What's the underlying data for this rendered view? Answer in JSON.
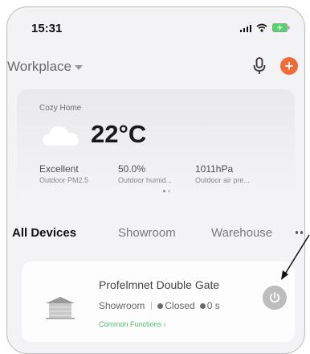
{
  "status_bar": {
    "time": "15:31"
  },
  "header": {
    "location": "Workplace"
  },
  "weather": {
    "home_name": "Cozy Home",
    "temperature": "22°C",
    "stats": [
      {
        "value": "Excellent",
        "label": "Outdoor PM2.5"
      },
      {
        "value": "50.0%",
        "label": "Outdoor humid..."
      },
      {
        "value": "1011hPa",
        "label": "Outdoor air pre..."
      }
    ]
  },
  "tabs": [
    "All Devices",
    "Showroom",
    "Warehouse"
  ],
  "device": {
    "name": "Profelmnet Double Gate",
    "room": "Showroom",
    "state": "Closed",
    "timer": "0 s",
    "common_functions": "Common Functions"
  },
  "colors": {
    "accent": "#f26a36",
    "functions_green": "#4fbf71",
    "power_gray": "#bdbdbd"
  }
}
